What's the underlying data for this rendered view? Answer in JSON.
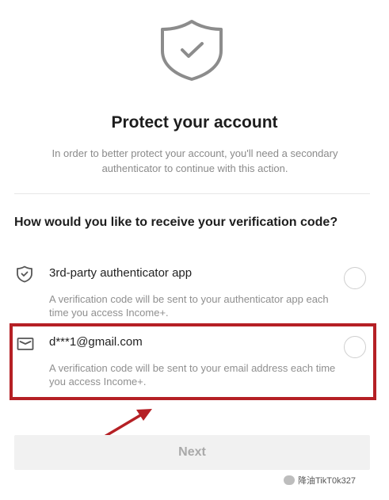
{
  "header": {
    "title": "Protect your account",
    "subtitle": "In order to better protect your account, you'll need a secondary authenticator to continue with this action."
  },
  "question": "How would you like to receive your verification code?",
  "options": [
    {
      "icon": "shield-check-icon",
      "label": "3rd-party authenticator app",
      "description": "A verification code will be sent to your authenticator app each time you access Income+.",
      "selected": false
    },
    {
      "icon": "envelope-icon",
      "label": "d***1@gmail.com",
      "description": "A verification code will be sent to your email address each time you access Income+.",
      "selected": false
    }
  ],
  "next_button": {
    "label": "Next",
    "enabled": false
  },
  "watermark": {
    "text": "降油TikT0k327"
  },
  "colors": {
    "highlight": "#b52025",
    "muted_text": "#8a8a8a"
  }
}
